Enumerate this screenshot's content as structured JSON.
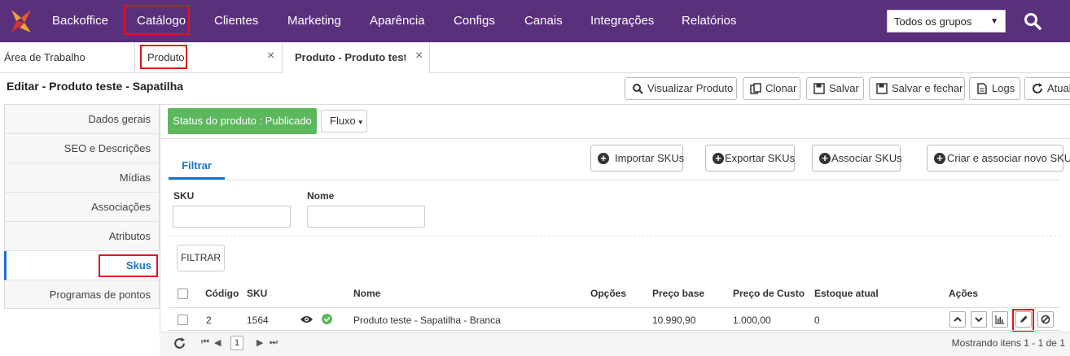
{
  "topnav": {
    "items": [
      "Backoffice",
      "Catálogo",
      "Clientes",
      "Marketing",
      "Aparência",
      "Configs",
      "Canais",
      "Integrações",
      "Relatórios"
    ],
    "group_select": "Todos os grupos",
    "brand_color": "#5a2f7c"
  },
  "tabs": {
    "workspace": "Área de Trabalho",
    "produto": "Produto",
    "active": "Produto - Produto teste",
    "close_glyph": "×"
  },
  "page": {
    "title": "Editar - Produto teste - Sapatilha",
    "toolbar": [
      "Visualizar Produto",
      "Clonar",
      "Salvar",
      "Salvar e fechar",
      "Logs",
      "Atual"
    ]
  },
  "sidemenu": {
    "items": [
      "Dados gerais",
      "SEO e Descrições",
      "Mídias",
      "Associações",
      "Atributos",
      "Skus",
      "Programas de pontos"
    ],
    "active": "Skus"
  },
  "status": {
    "label": "Status do produto : Publicado",
    "fluxo": "Fluxo",
    "color": "#5cb85c"
  },
  "filter": {
    "tab": "Filtrar",
    "sku_label": "SKU",
    "nome_label": "Nome",
    "button": "FILTRAR"
  },
  "actions": {
    "importar": "Importar SKUs",
    "exportar": "Exportar SKUs",
    "associar": "Associar SKUs",
    "criar": "Criar e associar novo SKU"
  },
  "grid": {
    "columns": [
      "Código",
      "SKU",
      "Nome",
      "Opções",
      "Preço base",
      "Preço de Custo",
      "Estoque atual",
      "Ações"
    ],
    "rows": [
      {
        "codigo": "2",
        "sku": "1564",
        "nome": "Produto teste - Sapatilha - Branca",
        "opcoes": "",
        "preco_base": "10.990,90",
        "preco_custo": "1.000,00",
        "estoque": "0"
      }
    ]
  },
  "pager": {
    "page": "1",
    "info": "Mostrando itens 1 - 1 de 1"
  }
}
